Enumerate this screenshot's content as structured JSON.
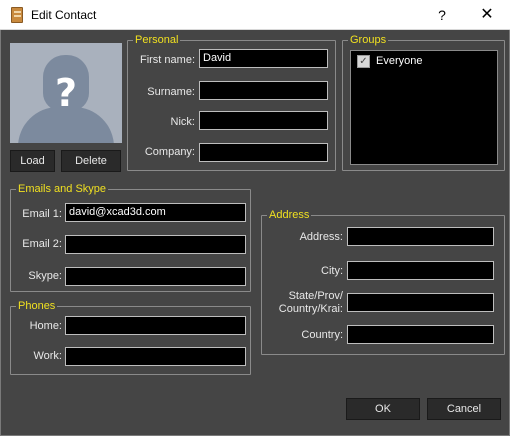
{
  "window": {
    "title": "Edit Contact",
    "help_glyph": "?",
    "close_glyph": "✕"
  },
  "photo": {
    "placeholder_glyph": "?",
    "load_label": "Load",
    "delete_label": "Delete"
  },
  "personal": {
    "legend": "Personal",
    "first_name_label": "First name:",
    "first_name_value": "David",
    "surname_label": "Surname:",
    "surname_value": "",
    "nick_label": "Nick:",
    "nick_value": "",
    "company_label": "Company:",
    "company_value": ""
  },
  "groups": {
    "legend": "Groups",
    "items": [
      {
        "label": "Everyone",
        "checked": true,
        "check_glyph": "✓"
      }
    ]
  },
  "emails": {
    "legend": "Emails and Skype",
    "email1_label": "Email 1:",
    "email1_value": "david@xcad3d.com",
    "email2_label": "Email 2:",
    "email2_value": "",
    "skype_label": "Skype:",
    "skype_value": ""
  },
  "phones": {
    "legend": "Phones",
    "home_label": "Home:",
    "home_value": "",
    "work_label": "Work:",
    "work_value": ""
  },
  "address": {
    "legend": "Address",
    "address_label": "Address:",
    "address_value": "",
    "city_label": "City:",
    "city_value": "",
    "state_label_line1": "State/Prov/",
    "state_label_line2": "Country/Krai:",
    "state_value": "",
    "country_label": "Country:",
    "country_value": ""
  },
  "footer": {
    "ok_label": "OK",
    "cancel_label": "Cancel"
  },
  "colors": {
    "background": "#454545",
    "legend_text": "#f0e020",
    "input_background": "#000000",
    "button_background": "#2a2a2a"
  }
}
